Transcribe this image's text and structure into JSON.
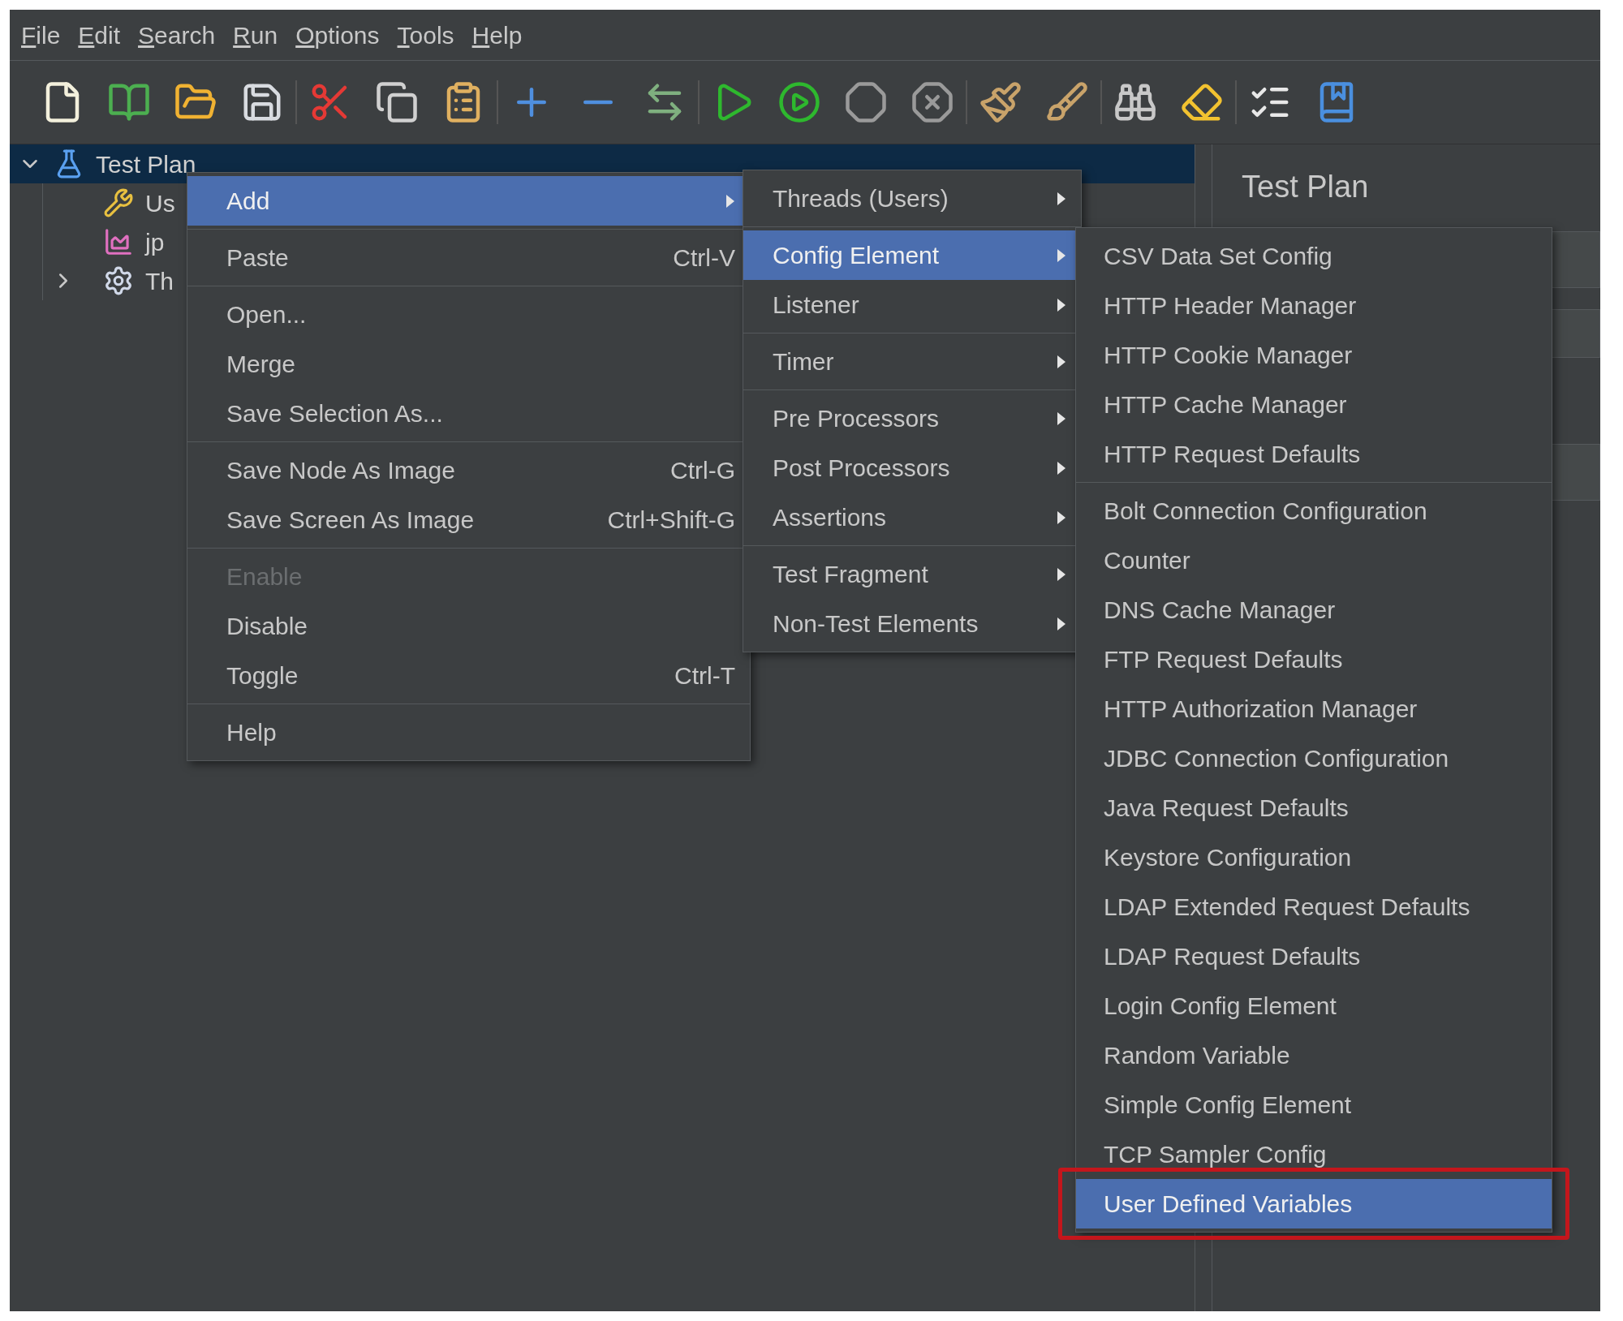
{
  "menubar": [
    "File",
    "Edit",
    "Search",
    "Run",
    "Options",
    "Tools",
    "Help"
  ],
  "tree": [
    {
      "label": "Test Plan",
      "selected": true,
      "expanded": true,
      "kind": "plan",
      "children": [
        {
          "label": "Us",
          "kind": "config"
        },
        {
          "label": "jp",
          "kind": "listener"
        },
        {
          "label": "Th",
          "kind": "threads",
          "expanded": false
        }
      ]
    }
  ],
  "detail_panel": {
    "title": "Test Plan"
  },
  "context_menu": {
    "groups": [
      [
        {
          "label": "Add",
          "submenu": true,
          "selected": true,
          "disabled": false
        }
      ],
      [
        {
          "label": "Paste",
          "shortcut": "Ctrl-V",
          "selected": false,
          "disabled": false
        }
      ],
      [
        {
          "label": "Open...",
          "selected": false,
          "disabled": false
        },
        {
          "label": "Merge",
          "selected": false,
          "disabled": false
        },
        {
          "label": "Save Selection As...",
          "selected": false,
          "disabled": false
        }
      ],
      [
        {
          "label": "Save Node As Image",
          "shortcut": "Ctrl-G",
          "selected": false,
          "disabled": false
        },
        {
          "label": "Save Screen As Image",
          "shortcut": "Ctrl+Shift-G",
          "selected": false,
          "disabled": false
        }
      ],
      [
        {
          "label": "Enable",
          "selected": false,
          "disabled": true
        },
        {
          "label": "Disable",
          "selected": false,
          "disabled": false
        },
        {
          "label": "Toggle",
          "shortcut": "Ctrl-T",
          "selected": false,
          "disabled": false
        }
      ],
      [
        {
          "label": "Help",
          "selected": false,
          "disabled": false
        }
      ]
    ]
  },
  "add_submenu": {
    "groups": [
      [
        {
          "label": "Threads (Users)",
          "submenu": true,
          "selected": false
        }
      ],
      [
        {
          "label": "Config Element",
          "submenu": true,
          "selected": true
        },
        {
          "label": "Listener",
          "submenu": true,
          "selected": false
        }
      ],
      [
        {
          "label": "Timer",
          "submenu": true,
          "selected": false
        }
      ],
      [
        {
          "label": "Pre Processors",
          "submenu": true,
          "selected": false
        },
        {
          "label": "Post Processors",
          "submenu": true,
          "selected": false
        },
        {
          "label": "Assertions",
          "submenu": true,
          "selected": false
        }
      ],
      [
        {
          "label": "Test Fragment",
          "submenu": true,
          "selected": false
        },
        {
          "label": "Non-Test Elements",
          "submenu": true,
          "selected": false
        }
      ]
    ]
  },
  "config_submenu": {
    "groups": [
      [
        {
          "label": "CSV Data Set Config",
          "selected": false,
          "outlined": false
        },
        {
          "label": "HTTP Header Manager",
          "selected": false,
          "outlined": false
        },
        {
          "label": "HTTP Cookie Manager",
          "selected": false,
          "outlined": false
        },
        {
          "label": "HTTP Cache Manager",
          "selected": false,
          "outlined": false
        },
        {
          "label": "HTTP Request Defaults",
          "selected": false,
          "outlined": false
        }
      ],
      [
        {
          "label": "Bolt Connection Configuration",
          "selected": false,
          "outlined": false
        },
        {
          "label": "Counter",
          "selected": false,
          "outlined": false
        },
        {
          "label": "DNS Cache Manager",
          "selected": false,
          "outlined": false
        },
        {
          "label": "FTP Request Defaults",
          "selected": false,
          "outlined": false
        },
        {
          "label": "HTTP Authorization Manager",
          "selected": false,
          "outlined": false
        },
        {
          "label": "JDBC Connection Configuration",
          "selected": false,
          "outlined": false
        },
        {
          "label": "Java Request Defaults",
          "selected": false,
          "outlined": false
        },
        {
          "label": "Keystore Configuration",
          "selected": false,
          "outlined": false
        },
        {
          "label": "LDAP Extended Request Defaults",
          "selected": false,
          "outlined": false
        },
        {
          "label": "LDAP Request Defaults",
          "selected": false,
          "outlined": false
        },
        {
          "label": "Login Config Element",
          "selected": false,
          "outlined": false
        },
        {
          "label": "Random Variable",
          "selected": false,
          "outlined": false
        },
        {
          "label": "Simple Config Element",
          "selected": false,
          "outlined": false
        },
        {
          "label": "TCP Sampler Config",
          "selected": false,
          "outlined": false
        },
        {
          "label": "User Defined Variables",
          "selected": true,
          "outlined": true
        }
      ]
    ]
  }
}
